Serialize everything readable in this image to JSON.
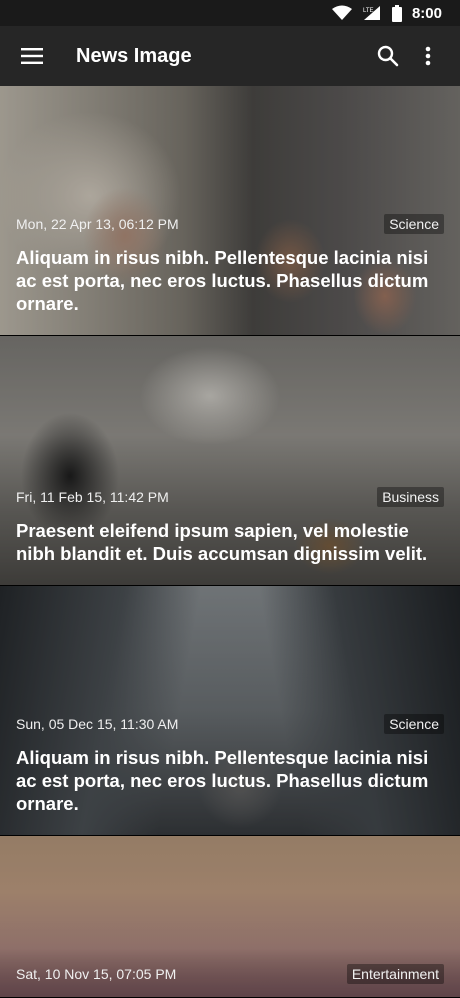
{
  "status_bar": {
    "time": "8:00",
    "icons": [
      "wifi-icon",
      "lte-signal-icon",
      "battery-icon"
    ],
    "network_label": "LTE"
  },
  "app_bar": {
    "title": "News Image",
    "menu_icon": "menu-icon",
    "search_icon": "search-icon",
    "more_icon": "more-vert-icon"
  },
  "articles": [
    {
      "date": "Mon, 22 Apr 13, 06:12 PM",
      "category": "Science",
      "title": "Aliquam in risus nibh. Pellentesque lacinia nisi ac est porta, nec eros luctus. Phasellus dictum ornare."
    },
    {
      "date": "Fri, 11 Feb 15, 11:42 PM",
      "category": "Business",
      "title": "Praesent eleifend ipsum sapien, vel molestie nibh blandit et. Duis accumsan dignissim velit."
    },
    {
      "date": "Sun, 05 Dec 15, 11:30 AM",
      "category": "Science",
      "title": "Aliquam in risus nibh. Pellentesque lacinia nisi ac est porta, nec eros luctus. Phasellus dictum ornare."
    },
    {
      "date": "Sat, 10 Nov 15, 07:05 PM",
      "category": "Entertainment",
      "title": ""
    }
  ]
}
